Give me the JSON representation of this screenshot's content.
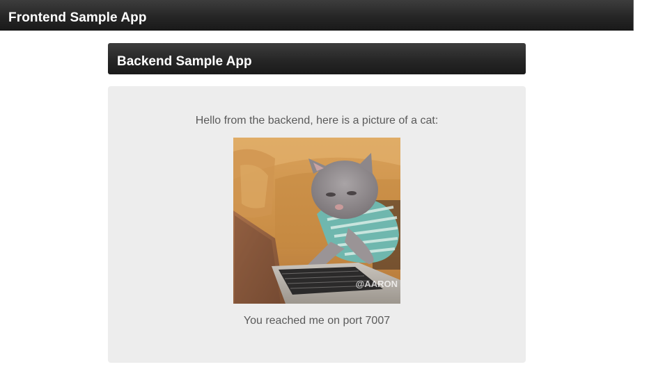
{
  "frontend": {
    "title": "Frontend Sample App"
  },
  "backend": {
    "title": "Backend Sample App",
    "greeting": "Hello from the backend, here is a picture of a cat:",
    "image": {
      "subject": "cat typing on laptop",
      "watermark": "@AARON"
    },
    "port_message": "You reached me on port 7007"
  }
}
